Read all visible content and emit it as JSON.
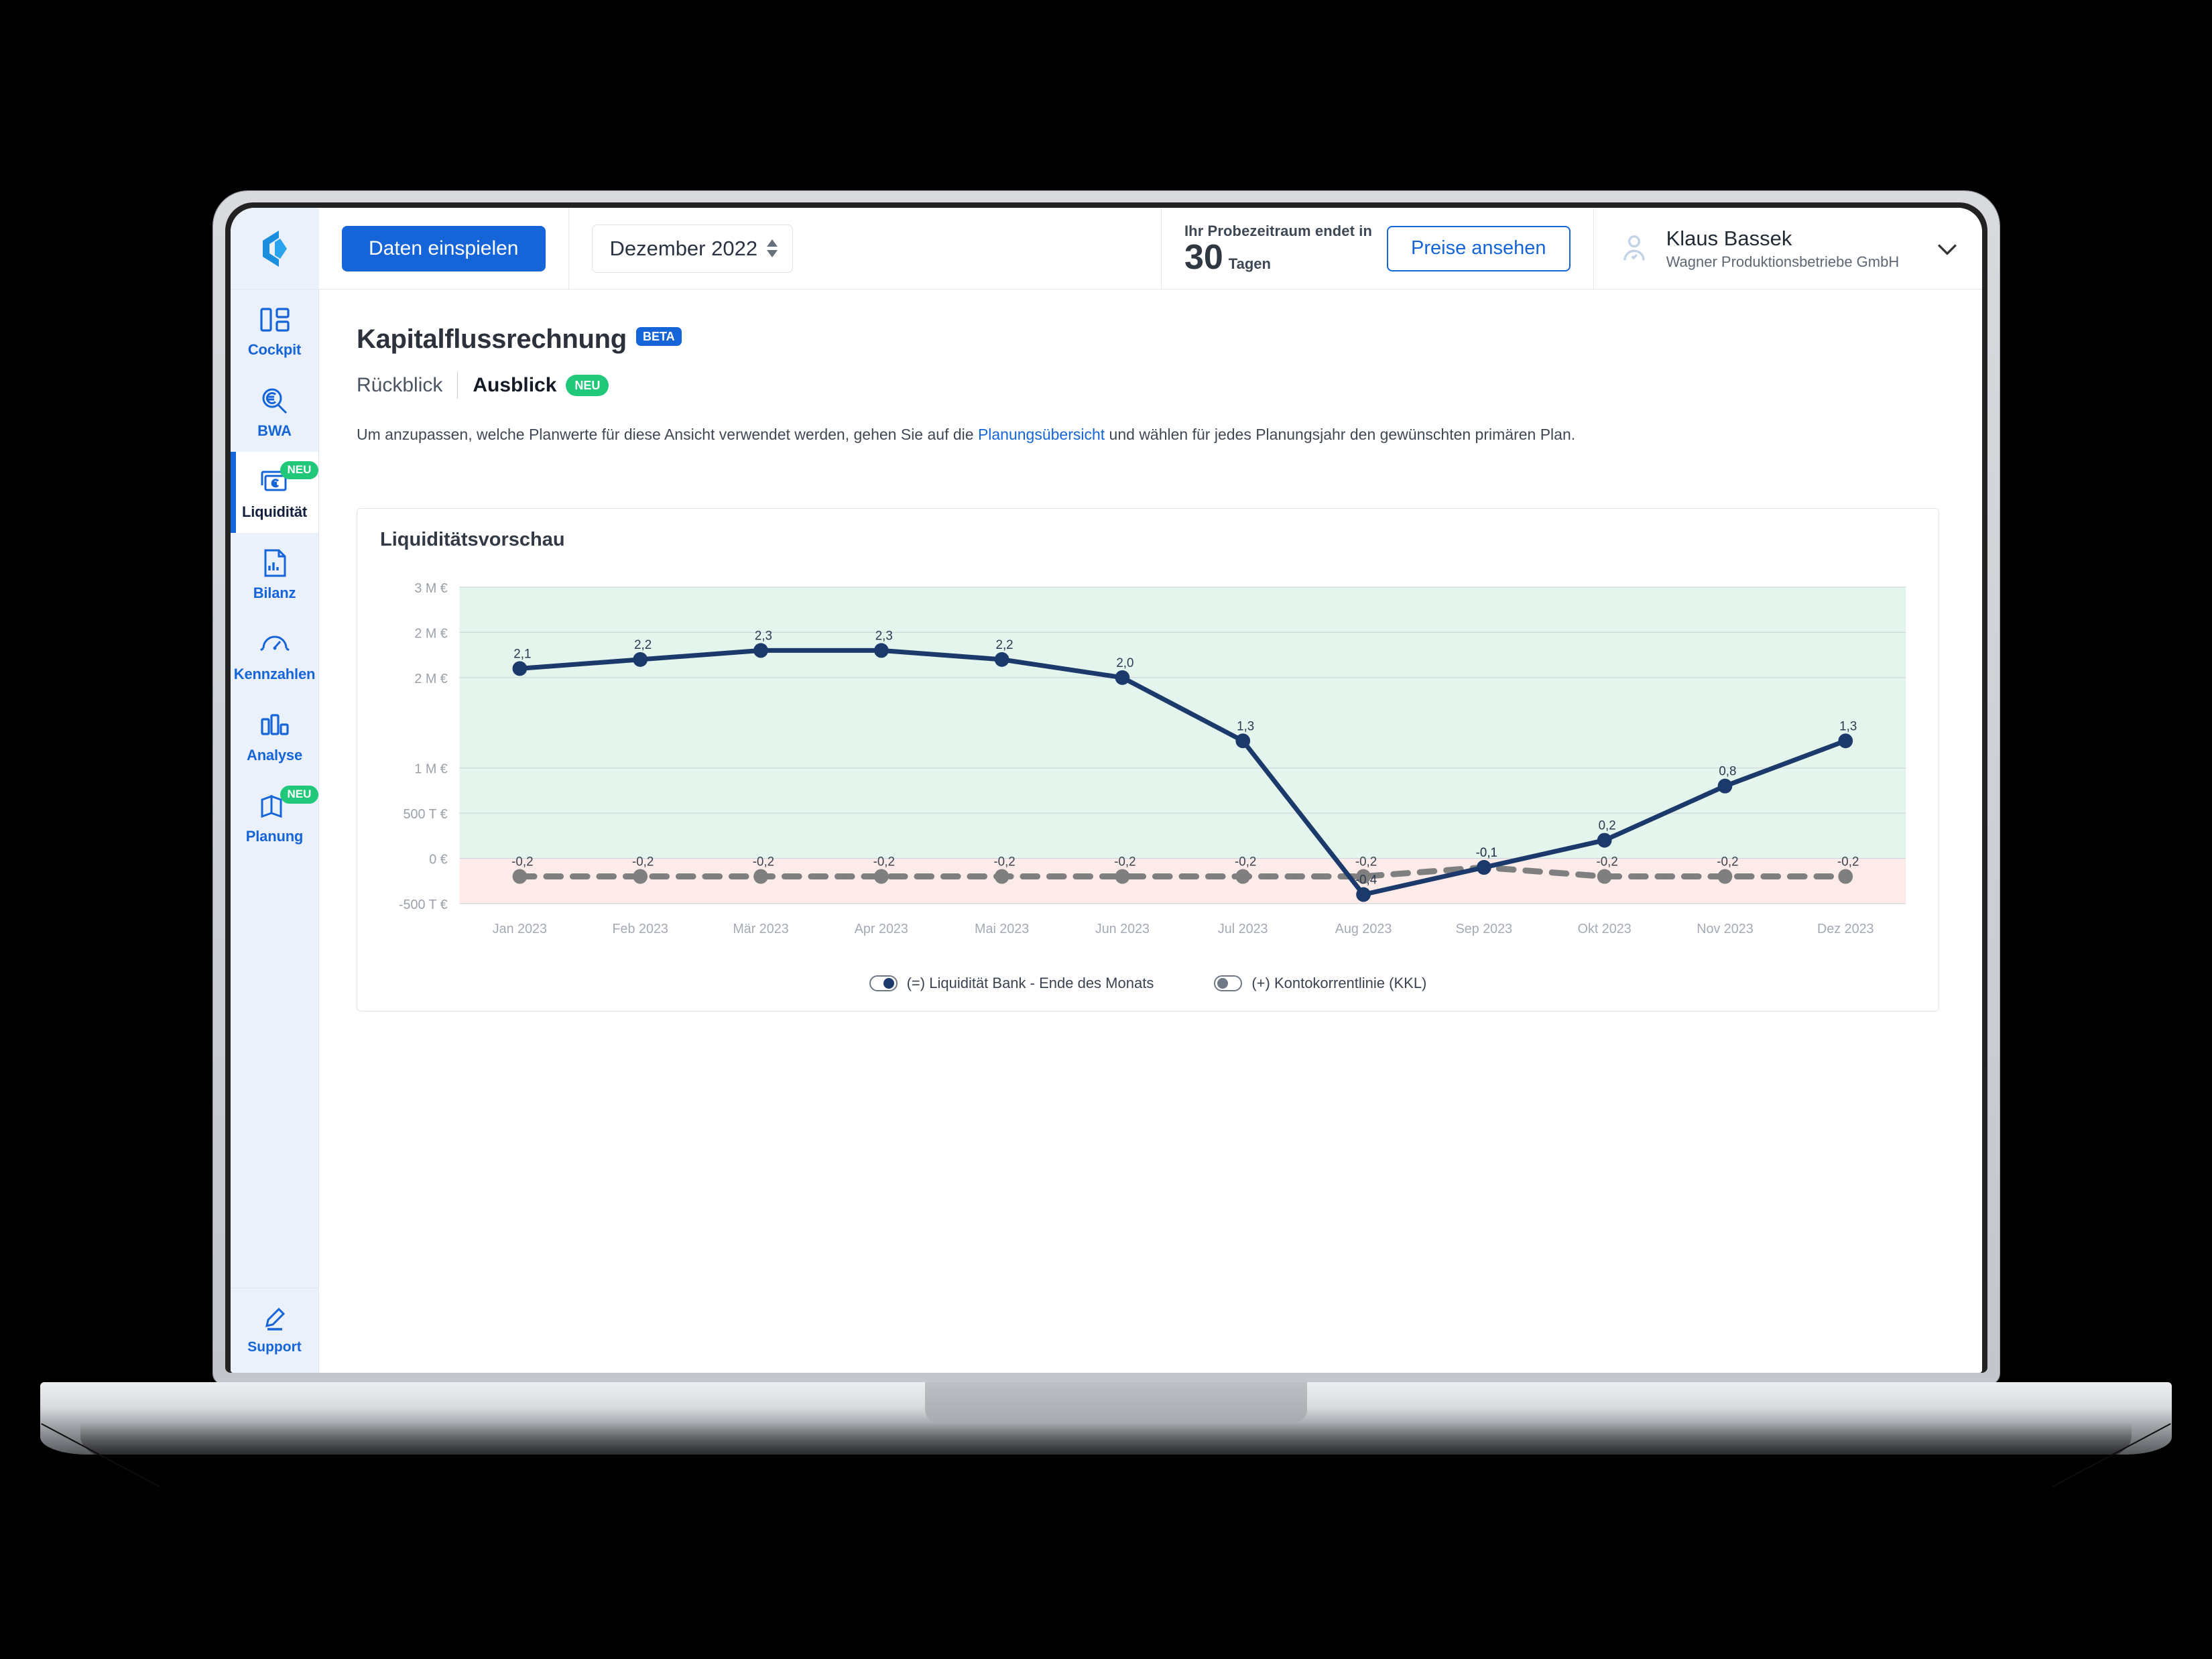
{
  "topbar": {
    "logo_icon": "company-logo-icon",
    "import_button": "Daten einspielen",
    "period_value": "Dezember 2022",
    "trial_line1": "Ihr Probezeitraum endet in",
    "trial_number": "30",
    "trial_unit": "Tagen",
    "pricing_button": "Preise ansehen",
    "user_name": "Klaus Bassek",
    "user_org": "Wagner Produktionsbetriebe GmbH"
  },
  "sidebar": {
    "items": [
      {
        "label": "Cockpit",
        "icon": "dashboard-icon",
        "badge": "",
        "active": false
      },
      {
        "label": "BWA",
        "icon": "euro-search-icon",
        "badge": "",
        "active": false
      },
      {
        "label": "Liquidität",
        "icon": "euro-cashflow-icon",
        "badge": "NEU",
        "active": true
      },
      {
        "label": "Bilanz",
        "icon": "document-chart-icon",
        "badge": "",
        "active": false
      },
      {
        "label": "Kennzahlen",
        "icon": "gauge-icon",
        "badge": "",
        "active": false
      },
      {
        "label": "Analyse",
        "icon": "bar-chart-icon",
        "badge": "",
        "active": false
      },
      {
        "label": "Planung",
        "icon": "map-book-icon",
        "badge": "NEU",
        "active": false
      }
    ],
    "support_label": "Support",
    "support_icon": "pencil-icon"
  },
  "page": {
    "title": "Kapitalflussrechnung",
    "title_badge": "BETA",
    "tab_inactive": "Rückblick",
    "tab_active": "Ausblick",
    "tab_badge": "NEU",
    "hint_before": "Um anzupassen, welche Planwerte für diese Ansicht verwendet werden, gehen Sie auf die ",
    "hint_link": "Planungsübersicht",
    "hint_after": " und wählen für jedes Planungsjahr den gewünschten primären Plan."
  },
  "colors": {
    "accent": "#1565d8",
    "series_line": "#1b3a6b",
    "kkl_line": "#7f7f7f",
    "band_positive": "#e3f5ec",
    "band_negative": "#fbe4e0",
    "badge_new": "#21c87a"
  },
  "chart_data": {
    "type": "line",
    "title": "Liquiditätsvorschau",
    "xlabel": "",
    "ylabel": "",
    "grid": true,
    "legend_position": "bottom",
    "categories": [
      "Jan 2023",
      "Feb 2023",
      "Mär 2023",
      "Apr 2023",
      "Mai 2023",
      "Jun 2023",
      "Jul 2023",
      "Aug 2023",
      "Sep 2023",
      "Okt 2023",
      "Nov 2023",
      "Dez 2023"
    ],
    "ytick_labels": [
      "3 M €",
      "2 M €",
      "2 M €",
      "1 M €",
      "500 T €",
      "0 €",
      "-500 T €"
    ],
    "ytick_values": [
      3000000,
      2500000,
      2000000,
      1000000,
      500000,
      0,
      -500000
    ],
    "ylim": [
      -500000,
      3000000
    ],
    "series": [
      {
        "name": "(=) Liquidität Bank - Ende des Monats",
        "color": "#1b3a6b",
        "toggle": "on",
        "style": "solid",
        "values": [
          2.1,
          2.2,
          2.3,
          2.3,
          2.2,
          2.0,
          1.3,
          -0.4,
          -0.1,
          0.2,
          0.8,
          1.3
        ],
        "labels": [
          "2,1",
          "2,2",
          "2,3",
          "2,3",
          "2,2",
          "2,0",
          "1,3",
          "-0,4",
          "-0,1",
          "0,2",
          "0,8",
          "1,3"
        ],
        "unit": "Mio €"
      },
      {
        "name": "(+) Kontokorrentlinie (KKL)",
        "color": "#7f7f7f",
        "toggle": "off",
        "style": "dashed",
        "values": [
          -0.2,
          -0.2,
          -0.2,
          -0.2,
          -0.2,
          -0.2,
          -0.2,
          -0.2,
          -0.1,
          -0.2,
          -0.2,
          -0.2
        ],
        "labels": [
          "-0,2",
          "-0,2",
          "-0,2",
          "-0,2",
          "-0,2",
          "-0,2",
          "-0,2",
          "-0,2",
          "-0,1",
          "-0,2",
          "-0,2",
          "-0,2"
        ],
        "unit": "Mio €"
      }
    ]
  }
}
